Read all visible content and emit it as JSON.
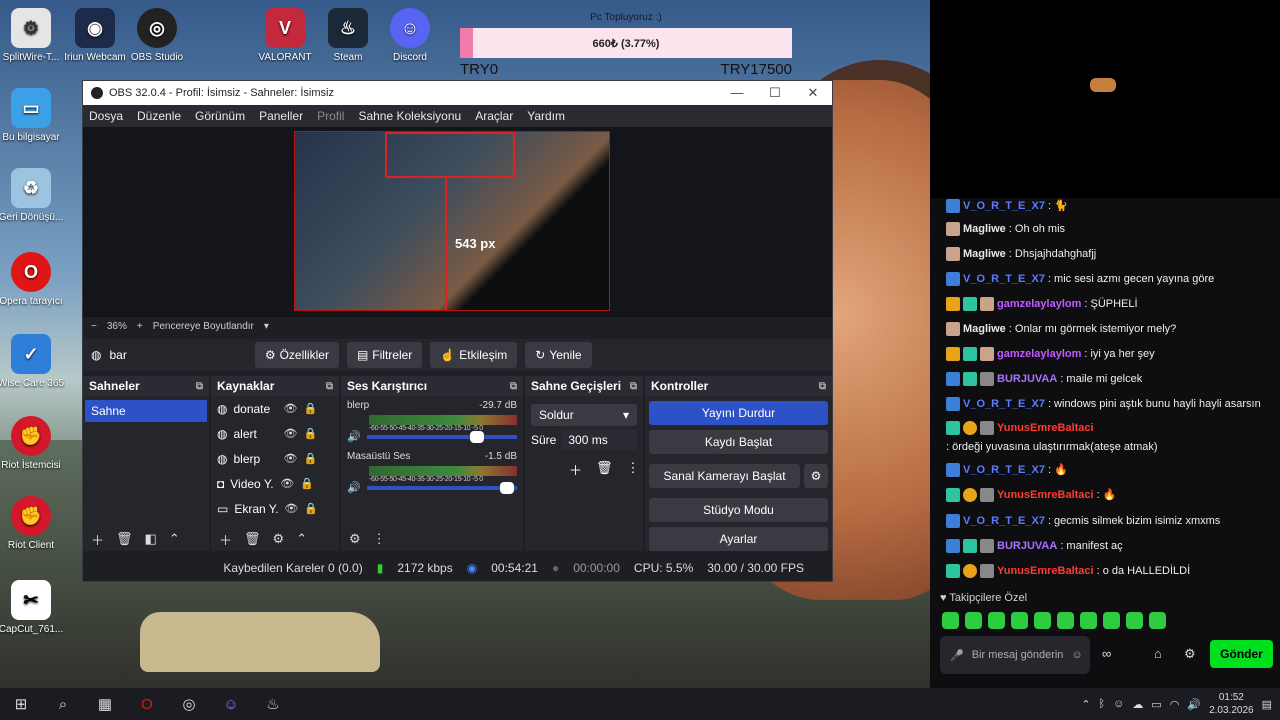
{
  "desktop": {
    "icons": [
      {
        "label": "SplitWire-T...",
        "glyph": "⚙"
      },
      {
        "label": "Iriun Webcam",
        "glyph": "◉"
      },
      {
        "label": "OBS Studio",
        "glyph": "◎"
      },
      {
        "label": "VALORANT",
        "glyph": "V"
      },
      {
        "label": "Steam",
        "glyph": "♨"
      },
      {
        "label": "Discord",
        "glyph": "☺"
      },
      {
        "label": "Bu bilgisayar",
        "glyph": "▭"
      },
      {
        "label": "Geri Dönüşü...",
        "glyph": "♻"
      },
      {
        "label": "Opera tarayıcı",
        "glyph": "O"
      },
      {
        "label": "Wise Care 365",
        "glyph": "✓"
      },
      {
        "label": "Riot İstemcisi",
        "glyph": "✊"
      },
      {
        "label": "Riot Client",
        "glyph": "✊"
      },
      {
        "label": "CapCut_761...",
        "glyph": "✂"
      }
    ]
  },
  "donation": {
    "title": "Pc Topluyoruz :)",
    "amount": "660₺ (3.77%)",
    "progress": 0.0377,
    "start": "TRY0",
    "goal": "TRY17500",
    "color": "#f07cab"
  },
  "obs": {
    "title": "OBS 32.0.4 - Profil: İsimsiz - Sahneler: İsimsiz",
    "window_controls": [
      "—",
      "☐",
      "✕"
    ],
    "menu": [
      "Dosya",
      "Düzenle",
      "Görünüm",
      "Paneller",
      "Profil",
      "Sahne Koleksiyonu",
      "Araçlar",
      "Yardım"
    ],
    "preview": {
      "overlay_text": "543 px"
    },
    "zoom": {
      "minus": "−",
      "value": "36%",
      "plus": "+",
      "fit": "Pencereye Boyutlandır",
      "caret": "▾"
    },
    "source_bar": {
      "name": "bar",
      "buttons": [
        "Özellikler",
        "Filtreler",
        "Etkileşim",
        "Yenile"
      ]
    },
    "scenes": {
      "title": "Sahneler",
      "items": [
        "Sahne"
      ]
    },
    "sources": {
      "title": "Kaynaklar",
      "items": [
        "donate",
        "alert",
        "blerp",
        "Video Y...",
        "Ekran Y..."
      ]
    },
    "mixer": {
      "title": "Ses Karıştırıcı",
      "scale": "-60-55-50-45-40-35-30-25-20-15-10 -5  0",
      "channels": [
        {
          "name": "blerp",
          "db": "-29.7 dB",
          "level": 0.78
        },
        {
          "name": "Masaüstü Ses",
          "db": "-1.5 dB",
          "level": 0.98
        }
      ]
    },
    "transitions": {
      "title": "Sahne Geçişleri",
      "type": "Soldur",
      "duration_label": "Süre",
      "duration": "300 ms"
    },
    "controls": {
      "title": "Kontroller",
      "buttons": [
        "Yayını Durdur",
        "Kaydı Başlat",
        "Sanal Kamerayı Başlat",
        "Stüdyo Modu",
        "Ayarlar"
      ]
    },
    "status": {
      "dropped": "Kaybedilen Kareler 0 (0.0)",
      "bitrate": "2172 kbps",
      "stream_time": "00:54:21",
      "rec_time": "00:00:00",
      "cpu": "CPU: 5.5%",
      "fps": "30.00 / 30.00 FPS"
    }
  },
  "chat": {
    "messages": [
      {
        "user": "V_O_R_T_E_X7",
        "text": ": 🐈",
        "color": "#5b7cff"
      },
      {
        "user": "Magliwe",
        "text": ": Oh oh mis",
        "color": "#e8e8e8"
      },
      {
        "user": "Magliwe",
        "text": ": Dhsjajhdahghafjj",
        "color": "#e8e8e8"
      },
      {
        "user": "V_O_R_T_E_X7",
        "text": ": mic sesi azmı gecen yayına göre",
        "color": "#5b7cff"
      },
      {
        "user": "gamzelaylaylom",
        "text": ": ŞÜPHELİ",
        "color": "#c05cff"
      },
      {
        "user": "Magliwe",
        "text": ": Onlar mı görmek istemiyor mely?",
        "color": "#e8e8e8"
      },
      {
        "user": "gamzelaylaylom",
        "text": ": iyi ya her şey",
        "color": "#c05cff"
      },
      {
        "user": "BURJUVAA",
        "text": ": maile mi gelcek",
        "color": "#a970ff"
      },
      {
        "user": "V_O_R_T_E_X7",
        "text": ": windows pini aştık bunu hayli hayli asarsın",
        "color": "#5b7cff"
      },
      {
        "user": "YunusEmreBaltaci",
        "text": ": ördeği yuvasına ulaştırırmak(ateşe atmak)",
        "color": "#ff3b30"
      },
      {
        "user": "V_O_R_T_E_X7",
        "text": ": 🔥",
        "color": "#5b7cff"
      },
      {
        "user": "YunusEmreBaltaci",
        "text": ": 🔥",
        "color": "#ff3b30"
      },
      {
        "user": "V_O_R_T_E_X7",
        "text": ": gecmis silmek bizim isimiz xmxms",
        "color": "#5b7cff"
      },
      {
        "user": "BURJUVAA",
        "text": ": manifest aç",
        "color": "#a970ff"
      },
      {
        "user": "YunusEmreBaltaci",
        "text": ": o da HALLEDİLDİ",
        "color": "#ff3b30"
      }
    ],
    "followers_only": "Takipçilere Özel",
    "input_placeholder": "Bir mesaj gönderin",
    "send": "Gönder"
  },
  "taskbar": {
    "time": "01:52",
    "date": "2.03.2026"
  }
}
